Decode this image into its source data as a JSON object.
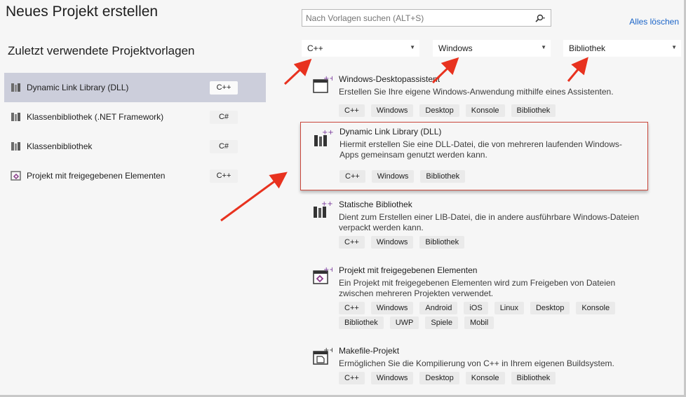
{
  "header": {
    "title": "Neues Projekt erstellen"
  },
  "recent": {
    "title": "Zuletzt verwendete Projektvorlagen",
    "items": [
      {
        "label": "Dynamic Link Library (DLL)",
        "lang": "C++",
        "icon": "dll-template-icon"
      },
      {
        "label": "Klassenbibliothek (.NET Framework)",
        "lang": "C#",
        "icon": "class-library-icon"
      },
      {
        "label": "Klassenbibliothek",
        "lang": "C#",
        "icon": "class-library-icon"
      },
      {
        "label": "Projekt mit freigegebenen Elementen",
        "lang": "C++",
        "icon": "shared-items-icon"
      }
    ]
  },
  "search": {
    "placeholder": "Nach Vorlagen suchen (ALT+S)",
    "icon": "search-icon"
  },
  "clear_all": "Alles löschen",
  "filters": {
    "language": "C++",
    "platform": "Windows",
    "project_type": "Bibliothek"
  },
  "templates": [
    {
      "name": "Windows-Desktopassistent",
      "desc": "Erstellen Sie Ihre eigene Windows-Anwendung mithilfe eines Assistenten.",
      "tags": [
        "C++",
        "Windows",
        "Desktop",
        "Konsole",
        "Bibliothek"
      ]
    },
    {
      "name": "Dynamic Link Library (DLL)",
      "desc": "Hiermit erstellen Sie eine DLL-Datei, die von mehreren laufenden Windows-Apps gemeinsam genutzt werden kann.",
      "tags": [
        "C++",
        "Windows",
        "Bibliothek"
      ]
    },
    {
      "name": "Statische Bibliothek",
      "desc": "Dient zum Erstellen einer LIB-Datei, die in andere ausführbare Windows-Dateien verpackt werden kann.",
      "tags": [
        "C++",
        "Windows",
        "Bibliothek"
      ]
    },
    {
      "name": "Projekt mit freigegebenen Elementen",
      "desc": "Ein Projekt mit freigegebenen Elementen wird zum Freigeben von Dateien zwischen mehreren Projekten verwendet.",
      "tags": [
        "C++",
        "Windows",
        "Android",
        "iOS",
        "Linux",
        "Desktop",
        "Konsole",
        "Bibliothek",
        "UWP",
        "Spiele",
        "Mobil"
      ]
    },
    {
      "name": "Makefile-Projekt",
      "desc": "Ermöglichen Sie die Kompilierung von C++ in Ihrem eigenen Buildsystem.",
      "tags": [
        "C++",
        "Windows",
        "Desktop",
        "Konsole",
        "Bibliothek"
      ]
    }
  ],
  "colors": {
    "accent_link": "#1a64c8",
    "selection": "#cccedb",
    "highlight_border": "#c9473b",
    "annotation_arrow": "#e8321f"
  }
}
